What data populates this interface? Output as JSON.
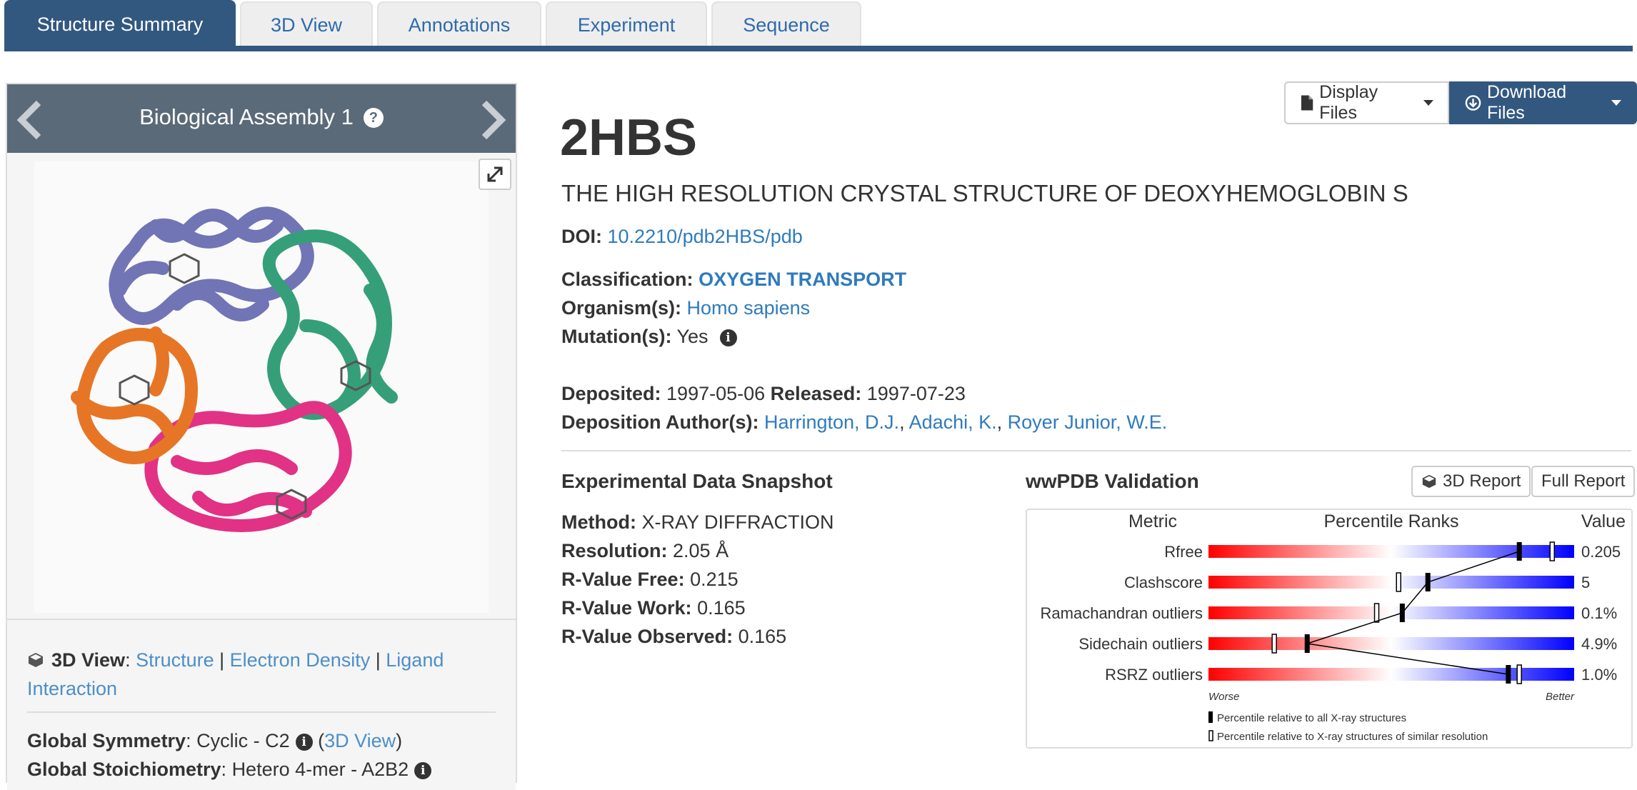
{
  "tabs": [
    {
      "label": "Structure Summary",
      "active": true
    },
    {
      "label": "3D View"
    },
    {
      "label": "Annotations"
    },
    {
      "label": "Experiment"
    },
    {
      "label": "Sequence"
    }
  ],
  "assembly": {
    "title": "Biological Assembly 1",
    "help_icon": "question-circle-icon",
    "chain_colors": [
      "#6a6db2",
      "#2b9b74",
      "#e0287f",
      "#e56f1a"
    ]
  },
  "footer": {
    "view_label": "3D View",
    "view_links": [
      "Structure",
      "Electron Density",
      "Ligand Interaction"
    ],
    "symmetry_label": "Global Symmetry",
    "symmetry_value": "Cyclic - C2",
    "symmetry_link": "3D View",
    "stoichiometry_label": "Global Stoichiometry",
    "stoichiometry_value": "Hetero 4-mer - A2B2"
  },
  "buttons": {
    "display_files": "Display Files",
    "download_files": "Download Files",
    "report_3d": "3D Report",
    "full_report": "Full Report"
  },
  "entry": {
    "id": "2HBS",
    "title": "THE HIGH RESOLUTION CRYSTAL STRUCTURE OF DEOXYHEMOGLOBIN S",
    "doi_label": "DOI:",
    "doi": "10.2210/pdb2HBS/pdb",
    "classification_label": "Classification:",
    "classification": "OXYGEN TRANSPORT",
    "organism_label": "Organism(s):",
    "organism": "Homo sapiens",
    "mutation_label": "Mutation(s):",
    "mutation": "Yes",
    "deposited_label": "Deposited:",
    "deposited": "1997-05-06",
    "released_label": "Released:",
    "released": "1997-07-23",
    "authors_label": "Deposition Author(s):",
    "authors": [
      "Harrington, D.J.",
      "Adachi, K.",
      "Royer Junior, W.E."
    ]
  },
  "experimental": {
    "title": "Experimental Data Snapshot",
    "rows": [
      {
        "label": "Method:",
        "value": "X-RAY DIFFRACTION"
      },
      {
        "label": "Resolution:",
        "value": "2.05 Å"
      },
      {
        "label": "R-Value Free:",
        "value": "0.215"
      },
      {
        "label": "R-Value Work:",
        "value": "0.165"
      },
      {
        "label": "R-Value Observed:",
        "value": "0.165"
      }
    ]
  },
  "validation": {
    "title": "wwPDB Validation",
    "col_metric": "Metric",
    "col_percentile": "Percentile Ranks",
    "col_value": "Value",
    "worse": "Worse",
    "better": "Better",
    "legend_all": "Percentile relative to all X-ray structures",
    "legend_similar": "Percentile relative to X-ray structures of similar resolution",
    "metrics": [
      {
        "name": "Rfree",
        "value": "0.205",
        "pct_all": 85,
        "pct_similar": 94
      },
      {
        "name": "Clashscore",
        "value": "5",
        "pct_all": 60,
        "pct_similar": 52
      },
      {
        "name": "Ramachandran outliers",
        "value": "0.1%",
        "pct_all": 53,
        "pct_similar": 46
      },
      {
        "name": "Sidechain outliers",
        "value": "4.9%",
        "pct_all": 27,
        "pct_similar": 18
      },
      {
        "name": "RSRZ outliers",
        "value": "1.0%",
        "pct_all": 82,
        "pct_similar": 85
      }
    ],
    "colors": {
      "worse": "#ff0000",
      "mid": "#ffffff",
      "better": "#0000ff"
    }
  }
}
